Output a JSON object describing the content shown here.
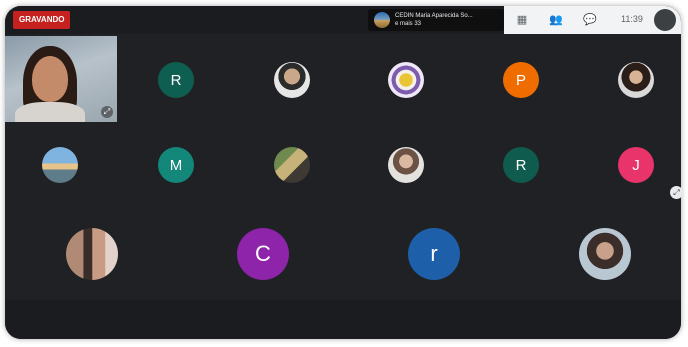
{
  "recording_label": "GRAVANDO",
  "pinned_speaker": {
    "name": "CEDIN Maria Aparecida So...",
    "more": "e mais 33"
  },
  "clock": "11:39",
  "controls": {
    "icons": [
      "grid-icon",
      "people-icon",
      "chat-icon"
    ]
  },
  "participants": [
    {
      "initial": "R",
      "color": "#0e5f52"
    },
    {
      "initial": "",
      "photo": "man"
    },
    {
      "initial": "",
      "photo": "logo"
    },
    {
      "initial": "P",
      "color": "#ef6c00"
    },
    {
      "initial": "",
      "photo": "woman"
    },
    {
      "initial": "",
      "photo": "landscape"
    },
    {
      "initial": "M",
      "color": "#12877a"
    },
    {
      "initial": "",
      "photo": "room"
    },
    {
      "initial": "",
      "photo": "woman"
    },
    {
      "initial": "R",
      "color": "#0f5b4e"
    },
    {
      "initial": "J",
      "color": "#e8336b"
    },
    {
      "initial": "",
      "photo": "group"
    },
    {
      "initial": "C",
      "color": "#8e24aa"
    },
    {
      "initial": "r",
      "color": "#1d5fa8"
    },
    {
      "initial": "",
      "photo": "woman"
    }
  ]
}
